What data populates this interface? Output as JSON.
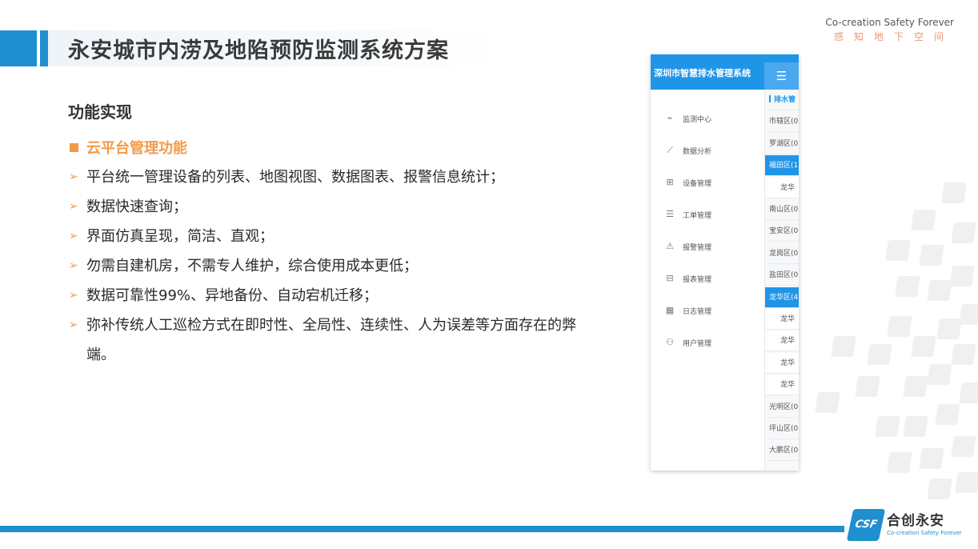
{
  "header": {
    "title": "永安城市内涝及地陷预防监测系统方案",
    "brand_en": "Co-creation Safety Forever",
    "brand_cn": "感知地下空间"
  },
  "content": {
    "section_title": "功能实现",
    "sub_heading": "云平台管理功能",
    "bullets": [
      "平台统一管理设备的列表、地图视图、数据图表、报警信息统计；",
      "数据快速查询；",
      "界面仿真呈现，简洁、直观；",
      "勿需自建机房，不需专人维护，综合使用成本更低；",
      "数据可靠性99%、异地备份、自动宕机迁移；",
      " 弥补传统人工巡检方式在即时性、全局性、连续性、人为误差等方面存在的弊端。"
    ]
  },
  "app": {
    "title": "深圳市智慧排水管理系统",
    "toggle_icon": "☰",
    "menu": [
      {
        "label": "监测中心",
        "icon": "monitor-icon",
        "glyph": "⌁"
      },
      {
        "label": "数据分析",
        "icon": "chart-line-icon",
        "glyph": "⟋"
      },
      {
        "label": "设备管理",
        "icon": "grid-icon",
        "glyph": "⊞"
      },
      {
        "label": "工单管理",
        "icon": "document-icon",
        "glyph": "☰"
      },
      {
        "label": "报警管理",
        "icon": "alarm-icon",
        "glyph": "⚠"
      },
      {
        "label": "报表管理",
        "icon": "report-icon",
        "glyph": "⊟"
      },
      {
        "label": "日志管理",
        "icon": "calendar-icon",
        "glyph": "▦"
      },
      {
        "label": "用户管理",
        "icon": "users-icon",
        "glyph": "⚇"
      }
    ],
    "districts": [
      {
        "label": "排水管",
        "kind": "head"
      },
      {
        "label": "市辖区(0",
        "kind": "normal"
      },
      {
        "label": "罗湖区(0",
        "kind": "normal"
      },
      {
        "label": "福田区(1",
        "kind": "active"
      },
      {
        "label": "龙华",
        "kind": "sub"
      },
      {
        "label": "南山区(0",
        "kind": "normal"
      },
      {
        "label": "宝安区(0",
        "kind": "normal"
      },
      {
        "label": "龙岗区(0",
        "kind": "normal"
      },
      {
        "label": "盐田区(0",
        "kind": "normal"
      },
      {
        "label": "龙华区(4",
        "kind": "active"
      },
      {
        "label": "龙华",
        "kind": "sub"
      },
      {
        "label": "龙华",
        "kind": "sub"
      },
      {
        "label": "龙华",
        "kind": "sub"
      },
      {
        "label": "龙华",
        "kind": "sub"
      },
      {
        "label": "光明区(0",
        "kind": "normal"
      },
      {
        "label": "坪山区(0",
        "kind": "normal"
      },
      {
        "label": "大鹏区(0",
        "kind": "normal"
      }
    ]
  },
  "footer": {
    "logo_mark": "CSF",
    "logo_cn": "合创永安",
    "logo_en": "Co-creation Safety Forever"
  },
  "colors": {
    "accent_blue": "#1f8fd0",
    "accent_orange": "#f29a4a",
    "app_blue": "#1f95e8"
  }
}
